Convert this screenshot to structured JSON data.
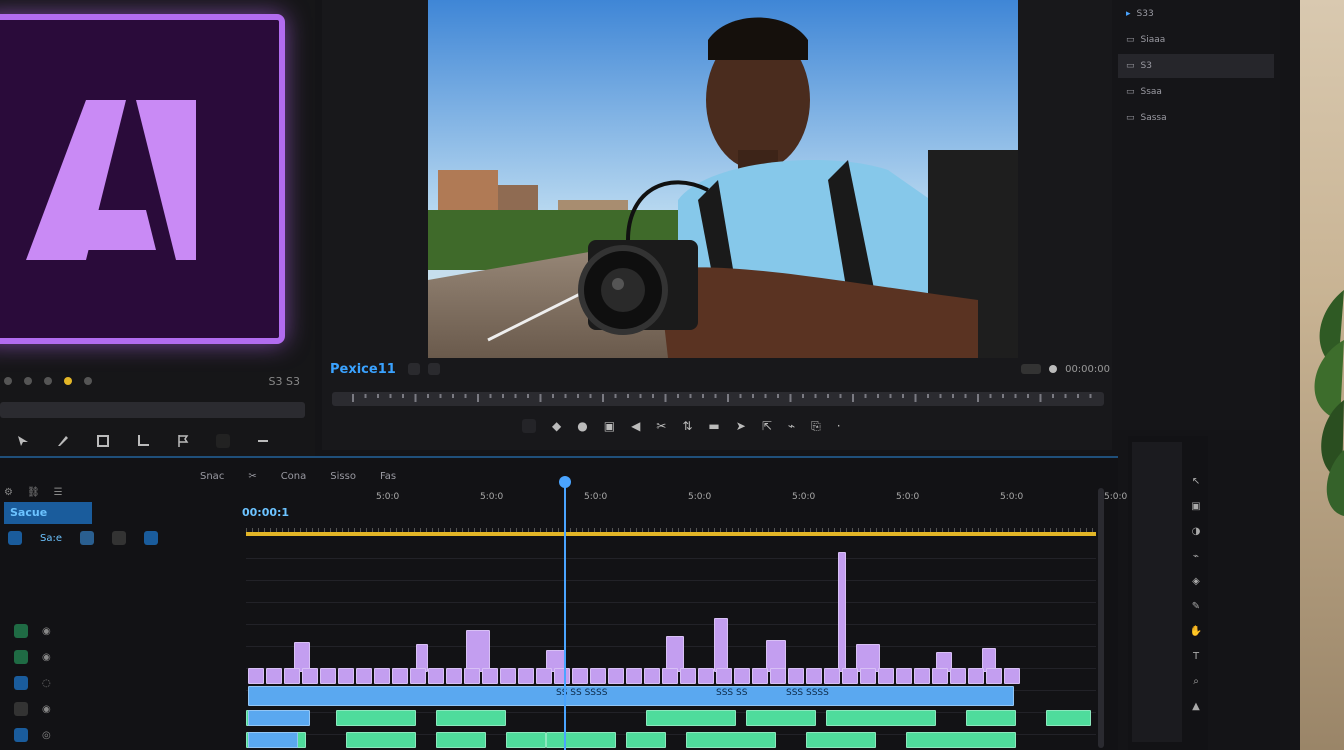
{
  "program_monitor": {
    "title": "Pexice11",
    "timecode_right": "00:00:00"
  },
  "timeline": {
    "sequence_tab": "Sacue",
    "sequence_tab2": "Sa:e",
    "timecode": "00:00:1",
    "header_items": [
      "Snac",
      "Cona",
      "Sisso",
      "Fas"
    ],
    "ruler_labels": [
      "5:0:0",
      "5:0:0",
      "5:0:0",
      "5:0:0",
      "5:0:0",
      "5:0:0",
      "5:0:0",
      "5:0:0"
    ],
    "clip_labels": [
      "SS SS SSSS",
      "SSS SS",
      "SSS SSSS"
    ]
  },
  "left_panel": {
    "controls_label": "S3 S3"
  },
  "right_panel": {
    "rows": [
      "S33",
      "Siaaa",
      "S3",
      "Ssaa",
      "Sassa"
    ]
  },
  "colors": {
    "accent_blue": "#3aa2ff",
    "logo_purple": "#b26cf0",
    "clip_purple": "#c39ef0",
    "clip_blue": "#5aa8f0",
    "clip_green": "#4fdc9c",
    "workarea_yellow": "#e3b627"
  },
  "icons": [
    "search-icon",
    "play-icon",
    "scissors-icon",
    "gear-icon",
    "export-icon"
  ]
}
